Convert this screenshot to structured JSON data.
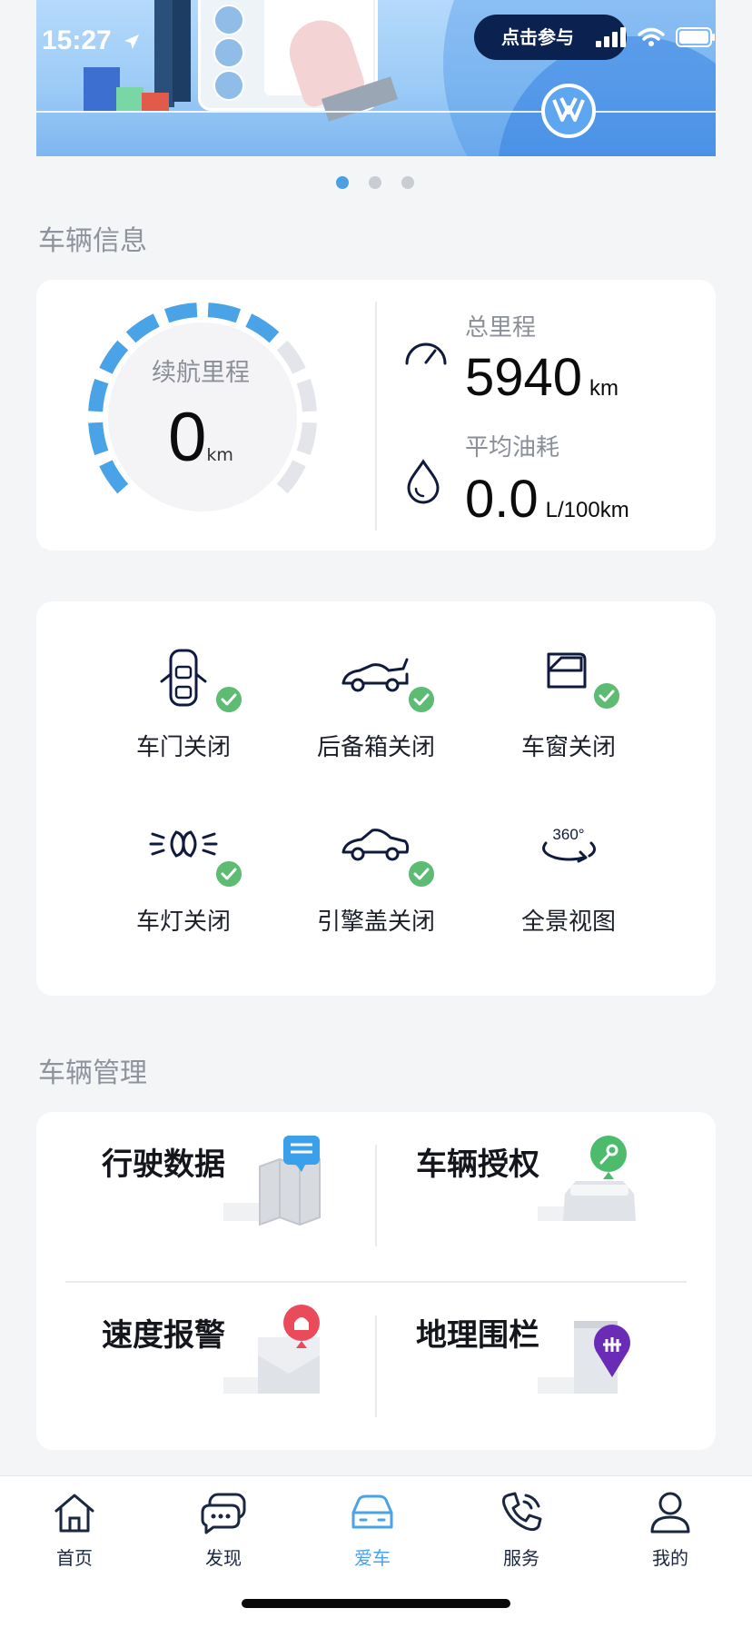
{
  "status_bar": {
    "time": "15:27"
  },
  "banner": {
    "cta_label": "点击参与",
    "page_index": 1,
    "page_count": 3
  },
  "vehicle_info": {
    "section_title": "车辆信息",
    "range": {
      "label": "续航里程",
      "value": "0",
      "unit": "km"
    },
    "total_mileage": {
      "label": "总里程",
      "value": "5940",
      "unit": "km",
      "icon": "speedometer-icon"
    },
    "avg_fuel": {
      "label": "平均油耗",
      "value": "0.0",
      "unit": "L/100km",
      "icon": "fuel-drop-icon"
    }
  },
  "vehicle_status": [
    {
      "label": "车门关闭",
      "icon": "car-door-icon",
      "checked": true
    },
    {
      "label": "后备箱关闭",
      "icon": "trunk-icon",
      "checked": true
    },
    {
      "label": "车窗关闭",
      "icon": "car-window-icon",
      "checked": true
    },
    {
      "label": "车灯关闭",
      "icon": "car-light-icon",
      "checked": true
    },
    {
      "label": "引擎盖关闭",
      "icon": "hood-icon",
      "checked": true
    },
    {
      "label": "全景视图",
      "icon": "panorama-360-icon",
      "checked": false
    }
  ],
  "panorama_badge": "360°",
  "vehicle_management": {
    "section_title": "车辆管理",
    "items": [
      {
        "label": "行驶数据",
        "icon": "map-chat-icon"
      },
      {
        "label": "车辆授权",
        "icon": "car-key-icon"
      },
      {
        "label": "速度报警",
        "icon": "mail-alarm-icon"
      },
      {
        "label": "地理围栏",
        "icon": "geofence-pin-icon"
      }
    ]
  },
  "tabbar": {
    "active": "爱车",
    "items": [
      {
        "label": "首页",
        "icon": "home-icon"
      },
      {
        "label": "发现",
        "icon": "chat-bubbles-icon"
      },
      {
        "label": "爱车",
        "icon": "car-icon"
      },
      {
        "label": "服务",
        "icon": "phone-icon"
      },
      {
        "label": "我的",
        "icon": "profile-icon"
      }
    ]
  },
  "colors": {
    "accent": "#4aa3e6",
    "navy": "#0b2150",
    "check_green": "#5dbb73",
    "gauge_gray": "#e4e5ea"
  }
}
